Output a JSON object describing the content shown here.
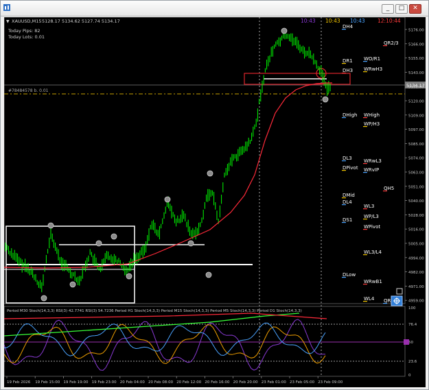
{
  "window": {
    "minimize_glyph": "_",
    "maximize_glyph": "□",
    "close_glyph": "✕"
  },
  "chart": {
    "symbol_label": "XAUUSD,M15",
    "ohlc": "5128.17 5134.62 5127.74 5134.17",
    "info_lines": [
      "Today Pips: 82",
      "Today Lots: 0.01"
    ],
    "order_line_label": "#78484578 b. 0.01",
    "current_price": "5134.17",
    "timers": [
      {
        "text": "10:43",
        "color": "#8b3ad6"
      },
      {
        "text": "10:43",
        "color": "#f2c500"
      },
      {
        "text": "10:43",
        "color": "#4aa3ff"
      },
      {
        "text": "12:10:44",
        "color": "#ff3b3b"
      }
    ],
    "price_axis": [
      "5176.00",
      "5166.00",
      "5155.00",
      "5143.00",
      "5132.00",
      "5120.00",
      "5109.00",
      "5097.00",
      "5085.00",
      "5074.00",
      "5063.00",
      "5051.00",
      "5040.00",
      "5028.00",
      "5016.00",
      "5005.00",
      "4994.00",
      "4982.00",
      "4971.00",
      "4959.00"
    ],
    "time_axis": [
      "19 Feb 2026",
      "19 Feb 15:00",
      "19 Feb 19:00",
      "19 Feb 23:00",
      "20 Feb 04:00",
      "20 Feb 08:00",
      "20 Feb 12:00",
      "20 Feb 16:00",
      "20 Feb 20:00",
      "23 Feb 01:00",
      "23 Feb 05:00",
      "23 Feb 09:00"
    ],
    "pivot_labels": [
      "DH4",
      "QR2/3",
      "DR1",
      "WO/R1",
      "DH3",
      "WRwH3",
      "DHigh",
      "WHigh",
      "WP/H3",
      "DL3",
      "WRwL3",
      "DPivot",
      "WRvIP",
      "QH5",
      "DMid",
      "DL4",
      "WL3",
      "WP/L3",
      "DS1",
      "WPivot",
      "WL3/L4",
      "DLow",
      "WRwB1",
      "WL4",
      "QR2"
    ],
    "indicator_header": "Period M30 Stoch(14,3,3)  RSI(3) 42.7741  RSI(3) 54.7236  Period H1 Stoch(14,3,3)  Period M15 Stoch(14,3,3)  Period M5 Stoch(14,3,3)  Period D1 Stoch(14,3,3)",
    "indicator_axis": [
      "100",
      "76.4",
      "50",
      "23.6",
      "0"
    ]
  },
  "colors": {
    "background": "#000000",
    "bull_candle": "#00ff00",
    "moving_average": "#ff2a3a",
    "grid_line": "#6f6f6f",
    "order_line": "#c8a000",
    "level_box": "#ffffff",
    "resistance_box": "#e0242c"
  },
  "icons": [
    "app-icon",
    "minimize-icon",
    "maximize-icon",
    "close-icon",
    "crosshair-icon"
  ]
}
